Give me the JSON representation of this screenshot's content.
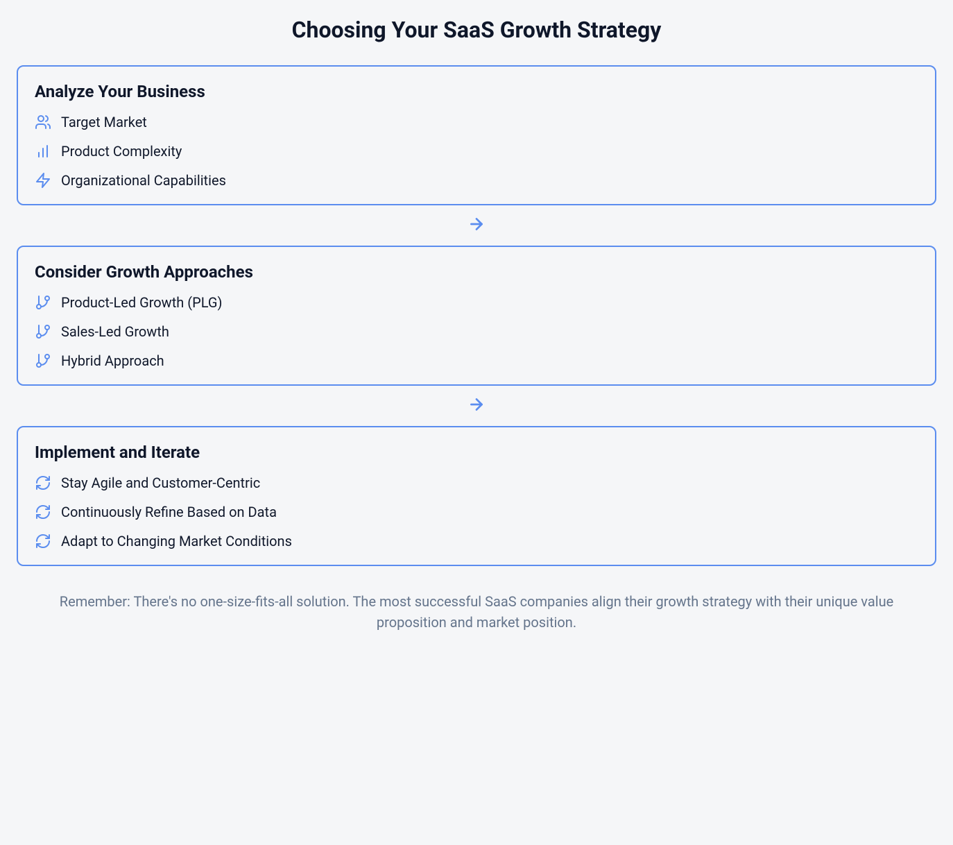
{
  "title": "Choosing Your SaaS Growth Strategy",
  "sections": [
    {
      "heading": "Analyze Your Business",
      "items": [
        {
          "icon": "users-icon",
          "label": "Target Market"
        },
        {
          "icon": "bar-chart-icon",
          "label": "Product Complexity"
        },
        {
          "icon": "zap-icon",
          "label": "Organizational Capabilities"
        }
      ]
    },
    {
      "heading": "Consider Growth Approaches",
      "items": [
        {
          "icon": "git-branch-icon",
          "label": "Product-Led Growth (PLG)"
        },
        {
          "icon": "git-branch-icon",
          "label": "Sales-Led Growth"
        },
        {
          "icon": "git-branch-icon",
          "label": "Hybrid Approach"
        }
      ]
    },
    {
      "heading": "Implement and Iterate",
      "items": [
        {
          "icon": "refresh-icon",
          "label": "Stay Agile and Customer-Centric"
        },
        {
          "icon": "refresh-icon",
          "label": "Continuously Refine Based on Data"
        },
        {
          "icon": "refresh-icon",
          "label": "Adapt to Changing Market Conditions"
        }
      ]
    }
  ],
  "footer": "Remember: There's no one-size-fits-all solution. The most successful SaaS companies align their growth strategy with their unique value proposition and market position."
}
